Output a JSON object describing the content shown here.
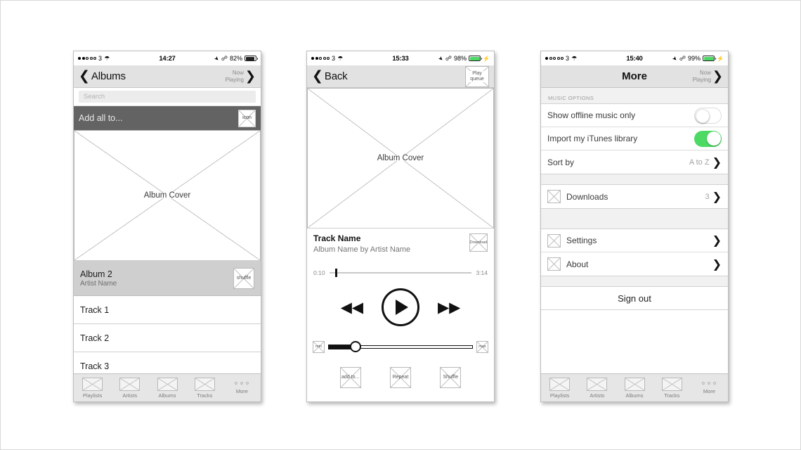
{
  "screens": {
    "albums": {
      "status": {
        "carrier": "3",
        "wifi_icon": "wifi-icon",
        "time": "14:27",
        "location_icon": "location-arrow-icon",
        "bluetooth_icon": "bluetooth-icon",
        "battery_percent": "82%",
        "battery_color": "#222222",
        "signal_filled": 2,
        "signal_total": 5
      },
      "nav": {
        "back_icon": "chevron-left-icon",
        "title": "Albums",
        "now_playing_line1": "Now",
        "now_playing_line2": "Playing",
        "now_playing_icon": "chevron-right-icon"
      },
      "search_placeholder": "Search",
      "add_all": {
        "label": "Add all to...",
        "icon_label": "icon"
      },
      "cover_label": "Album Cover",
      "album": {
        "title": "Album 2",
        "artist": "Artist Name",
        "shuffle_label": "shuffle"
      },
      "tracks": [
        "Track 1",
        "Track 2",
        "Track 3"
      ]
    },
    "player": {
      "status": {
        "carrier": "3",
        "wifi_icon": "wifi-icon",
        "time": "15:33",
        "location_icon": "location-arrow-icon",
        "bluetooth_icon": "bluetooth-icon",
        "battery_percent": "98%",
        "battery_color": "#4cd964",
        "charging_icon": "bolt-icon",
        "signal_filled": 2,
        "signal_total": 5
      },
      "nav": {
        "back_icon": "chevron-left-icon",
        "title": "Back",
        "queue_line1": "Play",
        "queue_line2": "queue"
      },
      "cover_label": "Album Cover",
      "track_name": "Track Name",
      "track_sub": "Album Name  by  Artist Name",
      "download_label": "Download",
      "time_elapsed": "0:10",
      "time_total": "3:14",
      "progress_percent": 5,
      "volume_percent": 18,
      "transport": {
        "prev_icon": "rewind-icon",
        "play_icon": "play-icon",
        "next_icon": "fast-forward-icon"
      },
      "volume": {
        "min_label": "min",
        "max_label": "max"
      },
      "actions": [
        {
          "label": "add to..."
        },
        {
          "label": "Repeat"
        },
        {
          "label": "Shuffle"
        }
      ]
    },
    "more": {
      "status": {
        "carrier": "3",
        "wifi_icon": "wifi-icon",
        "time": "15:40",
        "location_icon": "location-arrow-icon",
        "bluetooth_icon": "bluetooth-icon",
        "battery_percent": "99%",
        "battery_color": "#4cd964",
        "charging_icon": "bolt-icon",
        "signal_filled": 1,
        "signal_total": 5
      },
      "nav": {
        "title": "More",
        "now_playing_line1": "Now",
        "now_playing_line2": "Playing",
        "now_playing_icon": "chevron-right-icon"
      },
      "section_header": "MUSIC OPTIONS",
      "rows": {
        "offline": {
          "label": "Show offline music only",
          "state": "off"
        },
        "itunes": {
          "label": "Import my iTunes library",
          "state": "on"
        },
        "sort": {
          "label": "Sort by",
          "value": "A to Z"
        },
        "downloads": {
          "label": "Downloads",
          "count": "3"
        },
        "settings": {
          "label": "Settings"
        },
        "about": {
          "label": "About"
        }
      },
      "sign_out": "Sign out"
    }
  },
  "tabbar": {
    "items": [
      {
        "label": "Playlists"
      },
      {
        "label": "Artists"
      },
      {
        "label": "Albums"
      },
      {
        "label": "Tracks"
      }
    ],
    "more_label": "More"
  },
  "colors": {
    "accent_green": "#4cd964",
    "navbar_gray": "#e2e2e2",
    "addall_gray": "#636363",
    "album_row_gray": "#cfcfcf",
    "tabbar_gray": "#e6e6e6"
  }
}
